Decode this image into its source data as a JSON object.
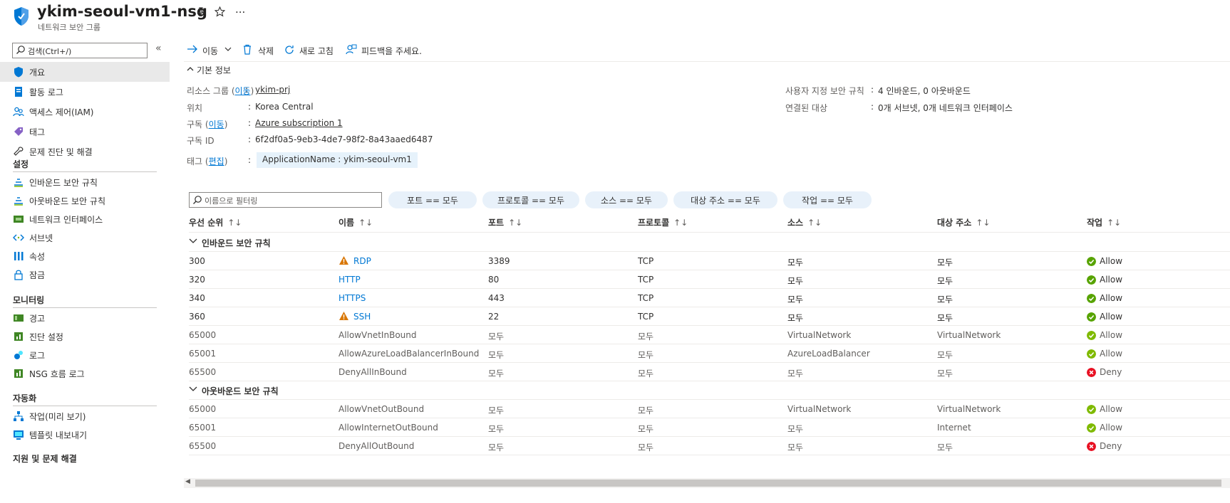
{
  "header": {
    "title": "ykim-seoul-vm1-nsg",
    "subtitle": "네트워크 보안 그룹",
    "pin_icon": "pin-icon",
    "favorite_icon": "star-icon",
    "more_label": "..."
  },
  "sidebar": {
    "search_placeholder": "검색(Ctrl+/)",
    "collapse_label": "«",
    "items": [
      {
        "label": "개요",
        "icon": "shield-icon"
      },
      {
        "label": "활동 로그",
        "icon": "log-icon"
      },
      {
        "label": "액세스 제어(IAM)",
        "icon": "people-icon"
      },
      {
        "label": "태그",
        "icon": "tag-icon"
      },
      {
        "label": "문제 진단 및 해결",
        "icon": "wrench-icon"
      }
    ],
    "sections": [
      {
        "title": "설정",
        "items": [
          {
            "label": "인바운드 보안 규칙",
            "icon": "inbound-icon"
          },
          {
            "label": "아웃바운드 보안 규칙",
            "icon": "outbound-icon"
          },
          {
            "label": "네트워크 인터페이스",
            "icon": "nic-icon"
          },
          {
            "label": "서브넷",
            "icon": "subnet-icon"
          },
          {
            "label": "속성",
            "icon": "properties-icon"
          },
          {
            "label": "잠금",
            "icon": "lock-icon"
          }
        ]
      },
      {
        "title": "모니터링",
        "items": [
          {
            "label": "경고",
            "icon": "alert-icon"
          },
          {
            "label": "진단 설정",
            "icon": "diagnostic-icon"
          },
          {
            "label": "로그",
            "icon": "logs-icon"
          },
          {
            "label": "NSG 흐름 로그",
            "icon": "flowlog-icon"
          }
        ]
      },
      {
        "title": "자동화",
        "items": [
          {
            "label": "작업(미리 보기)",
            "icon": "tasks-icon"
          },
          {
            "label": "템플릿 내보내기",
            "icon": "template-icon"
          }
        ]
      }
    ],
    "cut_section": "지원 및 문제 해결"
  },
  "toolbar": {
    "move_label": "이동",
    "delete_label": "삭제",
    "refresh_label": "새로 고침",
    "feedback_label": "피드백을 주세요."
  },
  "essentials": {
    "heading": "기본 정보",
    "resource_group_label": "리소스 그룹",
    "move_link": "이동",
    "resource_group_value": "ykim-prj",
    "location_label": "위치",
    "location_value": "Korea Central",
    "subscription_label": "구독",
    "subscription_value": "Azure subscription 1",
    "subscription_id_label": "구독 ID",
    "subscription_id_value": "6f2df0a5-9eb3-4de7-98f2-8a43aaed6487",
    "tags_label": "태그",
    "edit_link": "편집",
    "tag_value": "ApplicationName : ykim-seoul-vm1",
    "custom_rules_label": "사용자 지정 보안 규칙",
    "custom_rules_value": "4 인바운드, 0 아웃바운드",
    "associated_label": "연결된 대상",
    "associated_value": "0개 서브넷, 0개 네트워크 인터페이스"
  },
  "filters": {
    "placeholder": "이름으로 필터링",
    "pills": [
      "포트 == 모두",
      "프로토콜 == 모두",
      "소스 == 모두",
      "대상 주소 == 모두",
      "작업 == 모두"
    ]
  },
  "table": {
    "columns": [
      "우선 순위",
      "이름",
      "포트",
      "프로토콜",
      "소스",
      "대상 주소",
      "작업"
    ],
    "sort_glyph": "↑↓",
    "groups": [
      {
        "title": "인바운드 보안 규칙",
        "rows": [
          {
            "priority": "300",
            "name": "RDP",
            "port": "3389",
            "protocol": "TCP",
            "source": "모두",
            "destination": "모두",
            "action": "Allow",
            "warn": true,
            "custom": true
          },
          {
            "priority": "320",
            "name": "HTTP",
            "port": "80",
            "protocol": "TCP",
            "source": "모두",
            "destination": "모두",
            "action": "Allow",
            "warn": false,
            "custom": true
          },
          {
            "priority": "340",
            "name": "HTTPS",
            "port": "443",
            "protocol": "TCP",
            "source": "모두",
            "destination": "모두",
            "action": "Allow",
            "warn": false,
            "custom": true
          },
          {
            "priority": "360",
            "name": "SSH",
            "port": "22",
            "protocol": "TCP",
            "source": "모두",
            "destination": "모두",
            "action": "Allow",
            "warn": true,
            "custom": true
          },
          {
            "priority": "65000",
            "name": "AllowVnetInBound",
            "port": "모두",
            "protocol": "모두",
            "source": "VirtualNetwork",
            "destination": "VirtualNetwork",
            "action": "Allow",
            "warn": false,
            "custom": false
          },
          {
            "priority": "65001",
            "name": "AllowAzureLoadBalancerInBound",
            "port": "모두",
            "protocol": "모두",
            "source": "AzureLoadBalancer",
            "destination": "모두",
            "action": "Allow",
            "warn": false,
            "custom": false
          },
          {
            "priority": "65500",
            "name": "DenyAllInBound",
            "port": "모두",
            "protocol": "모두",
            "source": "모두",
            "destination": "모두",
            "action": "Deny",
            "warn": false,
            "custom": false
          }
        ]
      },
      {
        "title": "아웃바운드 보안 규칙",
        "rows": [
          {
            "priority": "65000",
            "name": "AllowVnetOutBound",
            "port": "모두",
            "protocol": "모두",
            "source": "VirtualNetwork",
            "destination": "VirtualNetwork",
            "action": "Allow",
            "warn": false,
            "custom": false
          },
          {
            "priority": "65001",
            "name": "AllowInternetOutBound",
            "port": "모두",
            "protocol": "모두",
            "source": "모두",
            "destination": "Internet",
            "action": "Allow",
            "warn": false,
            "custom": false
          },
          {
            "priority": "65500",
            "name": "DenyAllOutBound",
            "port": "모두",
            "protocol": "모두",
            "source": "모두",
            "destination": "모두",
            "action": "Deny",
            "warn": false,
            "custom": false
          }
        ]
      }
    ]
  },
  "colors": {
    "accent": "#0078d4",
    "allow": "#57a300",
    "allow_default": "#7fba00",
    "deny": "#e81123",
    "warning": "#d97706",
    "selected_nav": "#e9e9e9"
  }
}
